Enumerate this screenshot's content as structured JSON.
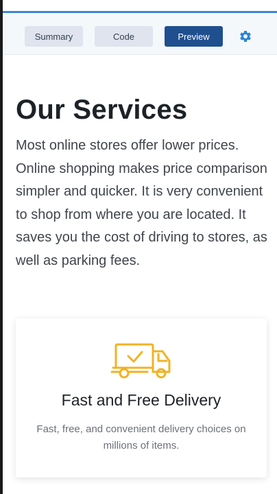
{
  "toolbar": {
    "tabs": [
      {
        "label": "Summary"
      },
      {
        "label": "Code"
      },
      {
        "label": "Preview"
      }
    ],
    "active_tab": "Preview"
  },
  "colors": {
    "accent": "#1f4f8f",
    "gear": "#2b86d0",
    "icon": "#f0b323"
  },
  "main": {
    "title": "Our Services",
    "intro": "Most online stores offer lower prices. Online shopping makes price comparison simpler and quicker. It is very convenient to shop from where you are located. It saves you the cost of driving to stores, as well as parking fees."
  },
  "card": {
    "icon": "delivery-truck-icon",
    "title": "Fast and Free Delivery",
    "description": "Fast, free, and convenient delivery choices on millions of items."
  }
}
